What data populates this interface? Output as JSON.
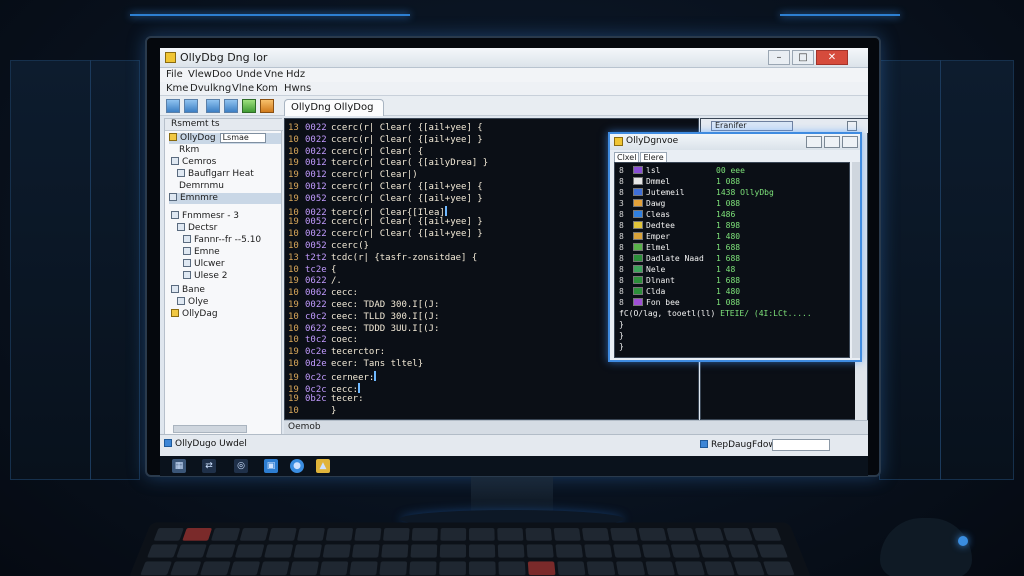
{
  "window": {
    "title": "OllyDbg Dng lor",
    "min": "–",
    "max": "□",
    "close": "✕"
  },
  "menu1": [
    "File",
    "Vlew",
    "Doo",
    "Unde",
    "Vne",
    "Hdz"
  ],
  "menu2": [
    "Kme",
    "Dvulkng",
    "Vlne",
    "Kom",
    "Hwns"
  ],
  "tab_label": "OllyDng OllyDog",
  "tree": {
    "header": "Rsmemt ts",
    "items": [
      {
        "label": "OllyDog",
        "field": "Lsmae"
      },
      {
        "label": "Rkm"
      },
      {
        "label": "Cemros"
      },
      {
        "label": "Bauflgarr Heat"
      },
      {
        "label": "Demrnmu"
      },
      {
        "label": "Emnmre"
      },
      {
        "label": "Fnmmesr - 3"
      },
      {
        "label": "Dectsr"
      },
      {
        "label": "Fannr--fr --5.10"
      },
      {
        "label": "Emne"
      },
      {
        "label": "Ulcwer"
      },
      {
        "label": "Ulese 2"
      },
      {
        "label": "Bane"
      },
      {
        "label": "Olye"
      },
      {
        "label": "OllyDag"
      }
    ]
  },
  "code_lines": [
    {
      "ln": "13",
      "addr": "0022",
      "text": "ccerc(r| Clear( {[ail+yee] {"
    },
    {
      "ln": "10",
      "addr": "0022",
      "text": "ccerc(r| Clear( {[ail+yee] }"
    },
    {
      "ln": "10",
      "addr": "0022",
      "text": "ccerc(r| Clear( {"
    },
    {
      "ln": "19",
      "addr": "0012",
      "text": "tcerc(r| Clear( {[ailyDrea] }"
    },
    {
      "ln": "19",
      "addr": "0012",
      "text": "ccerc(r| Clear|)"
    },
    {
      "ln": "19",
      "addr": "0012",
      "text": "ccerc(r| Clear( {[ail+yee] {"
    },
    {
      "ln": "19",
      "addr": "0052",
      "text": "ccerc(r| Clear( {[ail+yee] }"
    },
    {
      "ln": "10",
      "addr": "0022",
      "text": "tcerc(r| Clear{[Ilea]"
    },
    {
      "ln": "19",
      "addr": "0052",
      "text": "ccerc(r| Clear( {[ail+yee] }"
    },
    {
      "ln": "10",
      "addr": "0022",
      "text": "ccerc(r| Clear( {[ail+yee] }"
    },
    {
      "ln": "10",
      "addr": "0052",
      "text": "ccerc(}"
    },
    {
      "ln": "13",
      "addr": "t2t2",
      "text": "tcdc(r| {tasfr-zonsitdae] {"
    },
    {
      "ln": "10",
      "addr": "tc2e",
      "text": "{"
    },
    {
      "ln": "19",
      "addr": "0622",
      "text": "/."
    },
    {
      "ln": "10",
      "addr": "0062",
      "text": "cecc:"
    },
    {
      "ln": "19",
      "addr": "0022",
      "text": "ceec: TDAD 300.I[(J:"
    },
    {
      "ln": "10",
      "addr": "c0c2",
      "text": "ceec: TLLD 300.I[(J:"
    },
    {
      "ln": "10",
      "addr": "0622",
      "text": "ceec: TDDD 3UU.I[(J:"
    },
    {
      "ln": "10",
      "addr": "t0c2",
      "text": "coec:"
    },
    {
      "ln": "19",
      "addr": "0c2e",
      "text": "tecerctor:"
    },
    {
      "ln": "10",
      "addr": "0d2e",
      "text": "ecer: Tans tltel}"
    },
    {
      "ln": "19",
      "addr": "0c2c",
      "text": "cerneer:"
    },
    {
      "ln": "19",
      "addr": "0c2c",
      "text": "cecc:"
    },
    {
      "ln": "19",
      "addr": "0b2c",
      "text": "tecer:"
    },
    {
      "ln": "10",
      "addr": "",
      "text": "}"
    }
  ],
  "right_pane": {
    "search": "Eranifer"
  },
  "dialog": {
    "title": "OllyDgnvoe",
    "tabs": [
      "Clxel",
      "Elere"
    ],
    "rows": [
      {
        "n": "8",
        "color": "#8a4fd6",
        "name": "lsl",
        "value": "00 eee"
      },
      {
        "n": "8",
        "color": "#e7e7e7",
        "name": "Dmmel",
        "value": "1 088"
      },
      {
        "n": "8",
        "color": "#3f6fd8",
        "name": "Jutemeil",
        "value": "1438 OllyDbg"
      },
      {
        "n": "3",
        "color": "#e4a23a",
        "name": "Dawg",
        "value": "1 088"
      },
      {
        "n": "8",
        "color": "#2f7fe0",
        "name": "Cleas",
        "value": "1486"
      },
      {
        "n": "8",
        "color": "#e0c43a",
        "name": "Dedtee",
        "value": "1 898"
      },
      {
        "n": "8",
        "color": "#d9a23a",
        "name": "Emper",
        "value": "1 480"
      },
      {
        "n": "8",
        "color": "#59b04a",
        "name": "Elmel",
        "value": "1 688"
      },
      {
        "n": "8",
        "color": "#2c8f3a",
        "name": "Dadlate Naad",
        "value": "1 688"
      },
      {
        "n": "8",
        "color": "#3da35a",
        "name": "Nele",
        "value": "1 48"
      },
      {
        "n": "8",
        "color": "#2c8f3a",
        "name": "Dlnant",
        "value": "1 688"
      },
      {
        "n": "8",
        "color": "#2c8f3a",
        "name": "Clda",
        "value": "1 480"
      },
      {
        "n": "8",
        "color": "#9f4fd6",
        "name": "Fon bee",
        "value": "1 088"
      }
    ],
    "footer_line": "fC(O/lag, tooetl(ll)",
    "footer_val": "ETEIE/ (4I:LCt.....",
    "braces": [
      "}",
      "}",
      "}"
    ]
  },
  "status_strip": "Oemob",
  "bottom": {
    "left": "OllyDugo  Uwdel",
    "right": "RepDaugFdowy"
  },
  "taskbar_icons": [
    "start-icon",
    "network-icon",
    "search-icon",
    "folder-icon",
    "browser-icon",
    "app-icon"
  ]
}
